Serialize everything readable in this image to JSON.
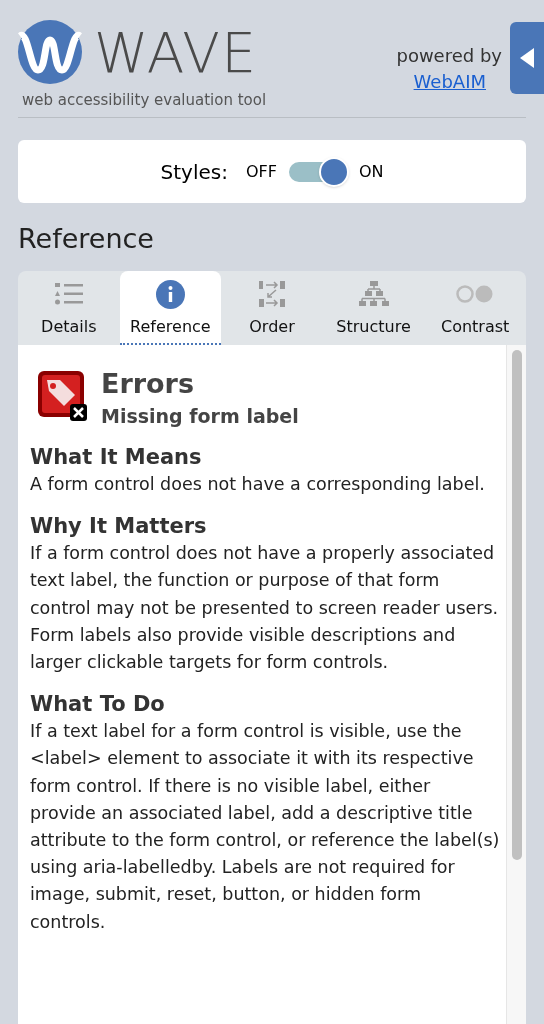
{
  "header": {
    "logo_text": "WAVE",
    "tagline": "web accessibility evaluation tool",
    "powered_by": "powered by",
    "link": "WebAIM"
  },
  "styles_toggle": {
    "label": "Styles:",
    "off_label": "OFF",
    "on_label": "ON",
    "on": true
  },
  "heading": "Reference",
  "tabs": [
    {
      "kind": "details",
      "label": "Details",
      "selected": false
    },
    {
      "kind": "reference",
      "label": "Reference",
      "selected": true
    },
    {
      "kind": "order",
      "label": "Order",
      "selected": false
    },
    {
      "kind": "structure",
      "label": "Structure",
      "selected": false
    },
    {
      "kind": "contrast",
      "label": "Contrast",
      "selected": false
    }
  ],
  "issue": {
    "category": "Errors",
    "title": "Missing form label"
  },
  "sections": [
    {
      "heading": "What It Means",
      "body": "A form control does not have a corresponding label."
    },
    {
      "heading": "Why It Matters",
      "body": "If a form control does not have a properly associated text label, the function or purpose of that form control may not be presented to screen reader users. Form labels also provide visible descriptions and larger clickable targets for form controls."
    },
    {
      "heading": "What To Do",
      "body": "If a text label for a form control is visible, use the <label> element to associate it with its respective form control. If there is no visible label, either provide an associated label, add a descriptive title attribute to the form control, or reference the label(s) using aria-labelledby. Labels are not required for image, submit, reset, button, or hidden form controls."
    }
  ]
}
